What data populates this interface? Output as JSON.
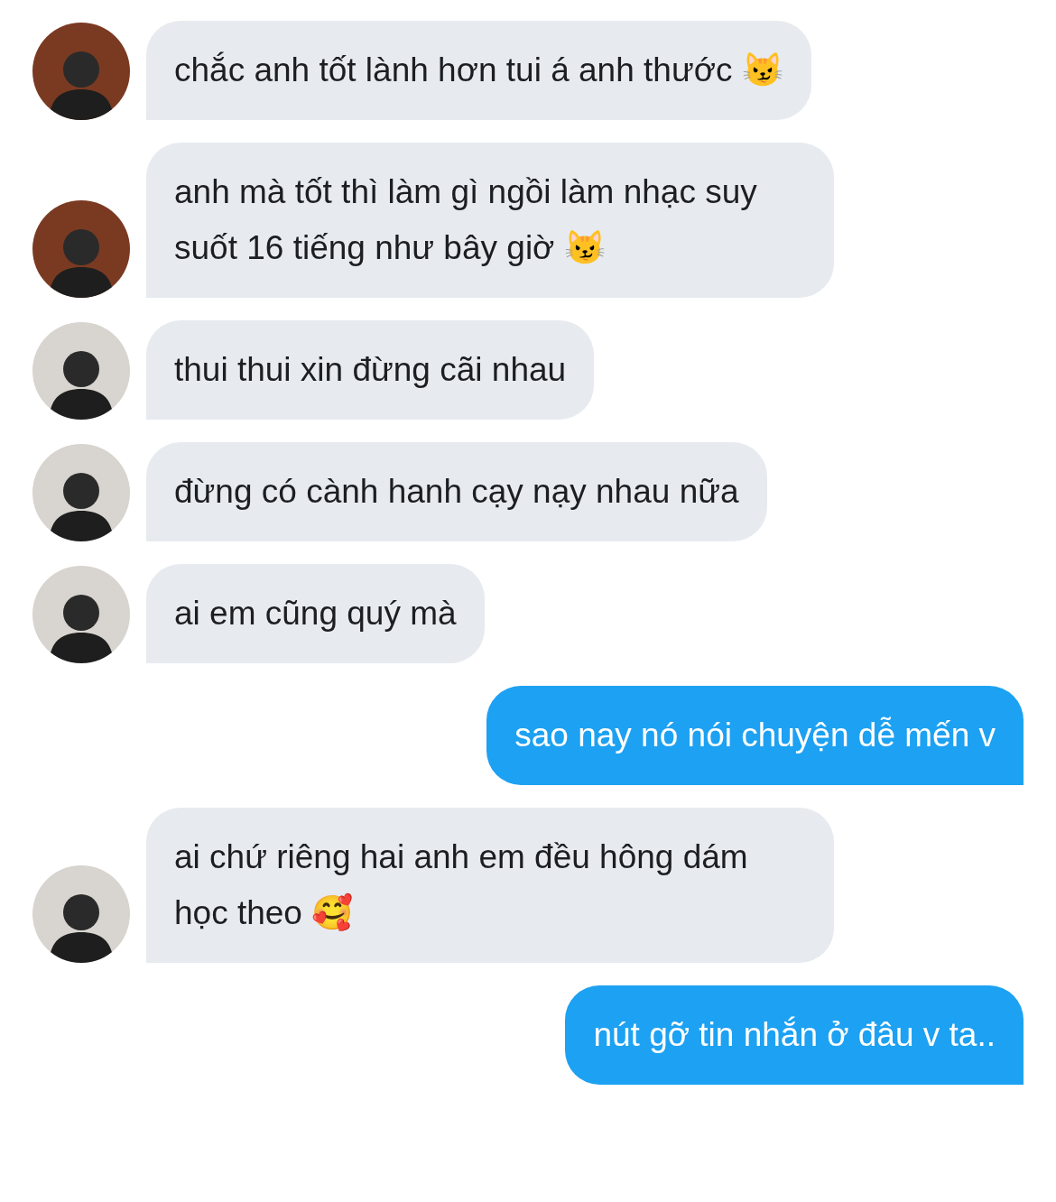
{
  "messages": [
    {
      "kind": "incoming",
      "color": "#7a3a22",
      "text": "chắc anh tốt lành hơn tui á anh thước 😼"
    },
    {
      "kind": "incoming",
      "color": "#7a3a22",
      "text": "anh mà tốt thì làm gì ngồi làm nhạc suy suốt 16 tiếng như bây giờ 😼"
    },
    {
      "kind": "incoming",
      "color": "#d8d4cf",
      "text": "thui thui xin đừng cãi nhau"
    },
    {
      "kind": "incoming",
      "color": "#d8d4cf",
      "text": "đừng có cành hanh cạy nạy nhau nữa"
    },
    {
      "kind": "incoming",
      "color": "#d8d4cf",
      "text": "ai em cũng quý mà"
    },
    {
      "kind": "outgoing",
      "text": "sao nay nó nói chuyện dễ mến v"
    },
    {
      "kind": "incoming",
      "color": "#d8d4cf",
      "text": "ai chứ riêng hai anh em đều hông dám học theo 🥰"
    },
    {
      "kind": "outgoing",
      "text": "nút gỡ tin nhắn ở đâu v ta.."
    }
  ]
}
